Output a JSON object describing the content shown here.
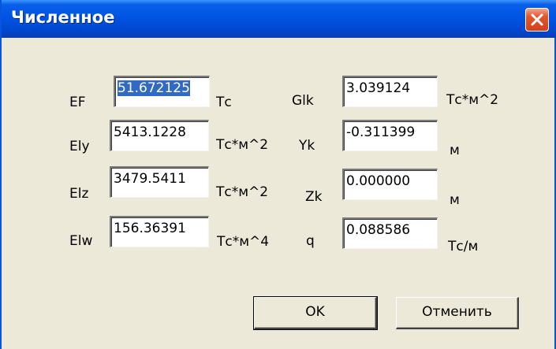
{
  "window": {
    "title": "Численное",
    "close_icon": "close-icon"
  },
  "rows_left": [
    {
      "label": "EF",
      "value": "51.672125",
      "unit": "Тс"
    },
    {
      "label": "Ely",
      "value": "5413.1228",
      "unit": "Тс*м^2"
    },
    {
      "label": "Elz",
      "value": "3479.5411",
      "unit": "Тс*м^2"
    },
    {
      "label": "Elw",
      "value": "156.36391",
      "unit": "Тс*м^4"
    }
  ],
  "rows_right": [
    {
      "label": "Glk",
      "value": "3.039124",
      "unit": "Тс*м^2"
    },
    {
      "label": "Yk",
      "value": "-0.311399",
      "unit": "м"
    },
    {
      "label": "Zk",
      "value": "0.000000",
      "unit": "м"
    },
    {
      "label": "q",
      "value": "0.088586",
      "unit": "Тс/м"
    }
  ],
  "buttons": {
    "ok": "OK",
    "cancel": "Отменить"
  },
  "colors": {
    "titlebar": "#0054e3",
    "selection": "#316ac5",
    "close_button": "#e2582e",
    "dialog_bg": "#ece9d8"
  }
}
